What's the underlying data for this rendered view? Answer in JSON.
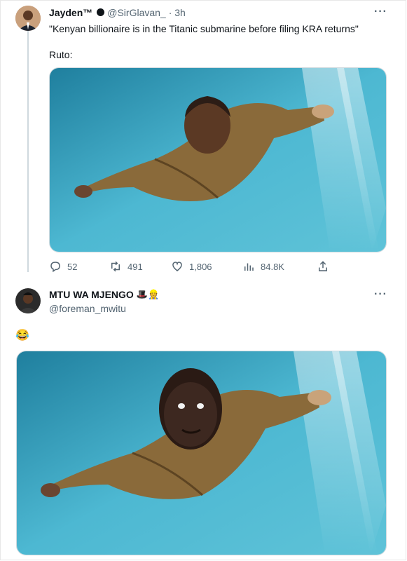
{
  "tweet1": {
    "display_name": "Jayden™",
    "handle": "@SirGlavan_",
    "time": "· 3h",
    "quote": "\"Kenyan billionaire is in the Titanic submarine before filing KRA returns\"",
    "body_text": "Ruto:",
    "more_icon": "more-dots-icon",
    "actions": {
      "replies": "52",
      "retweets": "491",
      "likes": "1,806",
      "views": "84.8K"
    }
  },
  "tweet2": {
    "display_name": "MTU WA MJENGO",
    "name_emojis": "🎩👷",
    "handle": "@foreman_mwitu",
    "body_emoji": "😂",
    "more_icon": "more-dots-icon"
  },
  "colors": {
    "text_primary": "#0f1419",
    "text_secondary": "#536471",
    "border": "#cfd9de",
    "water": "#3aa6c4"
  }
}
